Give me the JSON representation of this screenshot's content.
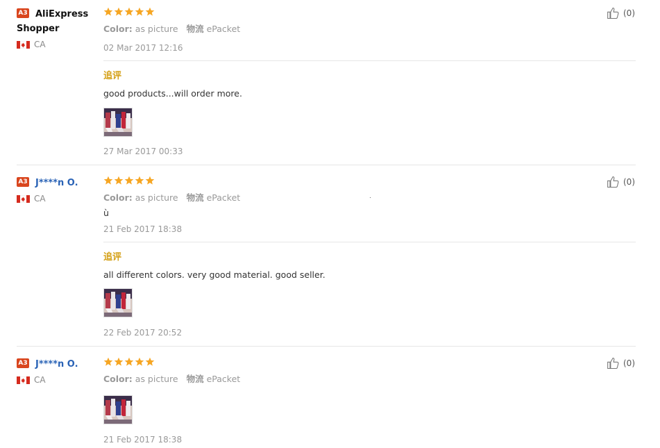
{
  "labels": {
    "color_label": "Color:",
    "shipping_label": "物流",
    "followup_label": "追评"
  },
  "reviews": [
    {
      "badge": "A3",
      "name": "AliExpress Shopper",
      "country": "CA",
      "stars": 5,
      "color_value": "as picture",
      "shipping_value": "ePacket",
      "text": "",
      "date": "02 Mar 2017 12:16",
      "likes": "(0)",
      "followup_text": "good products...will order more.",
      "followup_date": "27 Mar 2017 00:33"
    },
    {
      "badge": "A3",
      "name": "J****n O.",
      "country": "CA",
      "stars": 5,
      "color_value": "as picture",
      "shipping_value": "ePacket",
      "text": "ù",
      "date": "21 Feb 2017 18:38",
      "likes": "(0)",
      "followup_text": "all different colors. very good material. good seller.",
      "followup_date": "22 Feb 2017 20:52"
    },
    {
      "badge": "A3",
      "name": "J****n O.",
      "country": "CA",
      "stars": 5,
      "color_value": "as picture",
      "shipping_value": "ePacket",
      "text": "",
      "date": "21 Feb 2017 18:38",
      "likes": "(0)"
    }
  ],
  "colors": {
    "star": "#f6a623",
    "badge": "#d9461e",
    "followup": "#d4a017",
    "name_link": "#2a63b6"
  }
}
